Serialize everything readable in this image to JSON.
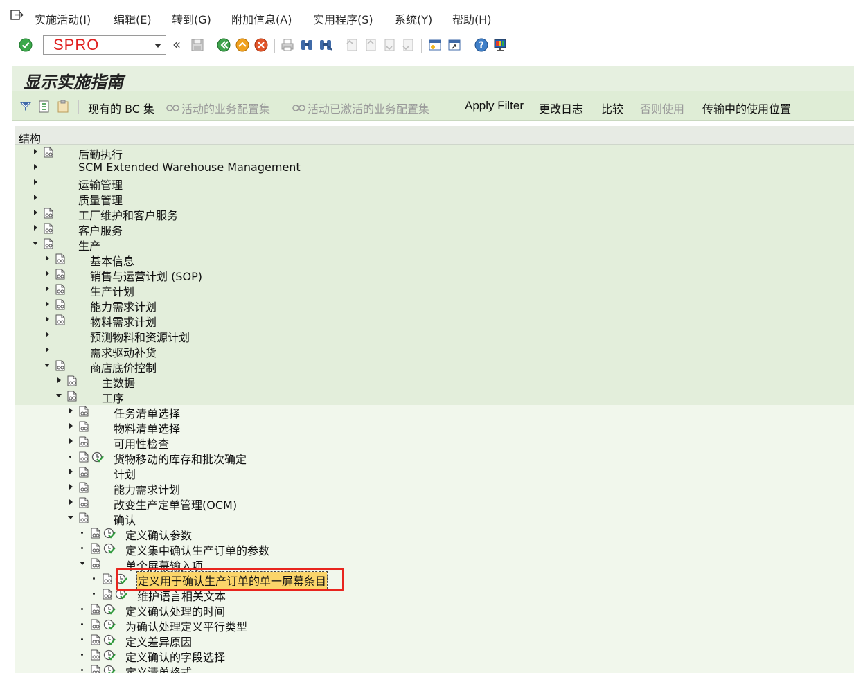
{
  "menu": {
    "items": [
      "实施活动(I)",
      "编辑(E)",
      "转到(G)",
      "附加信息(A)",
      "实用程序(S)",
      "系统(Y)",
      "帮助(H)"
    ]
  },
  "toolbar": {
    "command_value": "SPRO",
    "back_glyph": "«"
  },
  "screen": {
    "title": "显示实施指南"
  },
  "app_toolbar": {
    "current_bc_set": "现有的 BC 集",
    "active_config_sets": "活动的业务配置集",
    "activated_config_sets": "活动已激活的业务配置集",
    "apply_filter": "Apply Filter",
    "change_log": "更改日志",
    "compare": "比较",
    "where_used_else": "否则使用",
    "where_used_transport": "传输中的使用位置"
  },
  "tree": {
    "header": "结构",
    "rows": [
      {
        "label": "后勤执行",
        "expander": "r",
        "doc": true,
        "clock": false,
        "level": 0
      },
      {
        "label": "SCM Extended Warehouse Management",
        "expander": "r",
        "doc": false,
        "clock": false,
        "level": 0
      },
      {
        "label": "运输管理",
        "expander": "r",
        "doc": false,
        "clock": false,
        "level": 0
      },
      {
        "label": "质量管理",
        "expander": "r",
        "doc": false,
        "clock": false,
        "level": 0
      },
      {
        "label": "工厂维护和客户服务",
        "expander": "r",
        "doc": true,
        "clock": false,
        "level": 0
      },
      {
        "label": "客户服务",
        "expander": "r",
        "doc": true,
        "clock": false,
        "level": 0
      },
      {
        "label": "生产",
        "expander": "d",
        "doc": true,
        "clock": false,
        "level": 0
      },
      {
        "label": "基本信息",
        "expander": "r",
        "doc": true,
        "clock": false,
        "level": 1
      },
      {
        "label": "销售与运营计划 (SOP)",
        "expander": "r",
        "doc": true,
        "clock": false,
        "level": 1
      },
      {
        "label": "生产计划",
        "expander": "r",
        "doc": true,
        "clock": false,
        "level": 1
      },
      {
        "label": "能力需求计划",
        "expander": "r",
        "doc": true,
        "clock": false,
        "level": 1
      },
      {
        "label": "物料需求计划",
        "expander": "r",
        "doc": true,
        "clock": false,
        "level": 1
      },
      {
        "label": "预测物料和资源计划",
        "expander": "r",
        "doc": false,
        "clock": false,
        "level": 1
      },
      {
        "label": "需求驱动补货",
        "expander": "r",
        "doc": false,
        "clock": false,
        "level": 1
      },
      {
        "label": "商店底价控制",
        "expander": "d",
        "doc": true,
        "clock": false,
        "level": 1
      },
      {
        "label": "主数据",
        "expander": "r",
        "doc": true,
        "clock": false,
        "level": 2
      },
      {
        "label": "工序",
        "expander": "d",
        "doc": true,
        "clock": false,
        "level": 2
      },
      {
        "label": "任务清单选择",
        "expander": "r",
        "doc": true,
        "clock": false,
        "level": 3
      },
      {
        "label": "物料清单选择",
        "expander": "r",
        "doc": true,
        "clock": false,
        "level": 3
      },
      {
        "label": "可用性检查",
        "expander": "r",
        "doc": true,
        "clock": false,
        "level": 3
      },
      {
        "label": "货物移动的库存和批次确定",
        "expander": "b",
        "doc": true,
        "clock": true,
        "level": 3
      },
      {
        "label": "计划",
        "expander": "r",
        "doc": true,
        "clock": false,
        "level": 3
      },
      {
        "label": "能力需求计划",
        "expander": "r",
        "doc": true,
        "clock": false,
        "level": 3
      },
      {
        "label": "改变生产定单管理(OCM)",
        "expander": "r",
        "doc": true,
        "clock": false,
        "level": 3
      },
      {
        "label": "确认",
        "expander": "d",
        "doc": true,
        "clock": false,
        "level": 3
      },
      {
        "label": "定义确认参数",
        "expander": "b",
        "doc": true,
        "clock": true,
        "level": 4
      },
      {
        "label": "定义集中确认生产订单的参数",
        "expander": "b",
        "doc": true,
        "clock": true,
        "level": 4
      },
      {
        "label": "单个屏幕输入项",
        "expander": "d",
        "doc": true,
        "clock": false,
        "level": 4
      },
      {
        "label": "定义用于确认生产订单的单一屏幕条目",
        "expander": "b",
        "doc": true,
        "clock": true,
        "level": 5,
        "selected": true
      },
      {
        "label": "维护语言相关文本",
        "expander": "b",
        "doc": true,
        "clock": true,
        "level": 5
      },
      {
        "label": "定义确认处理的时间",
        "expander": "b",
        "doc": true,
        "clock": true,
        "level": 4
      },
      {
        "label": "为确认处理定义平行类型",
        "expander": "b",
        "doc": true,
        "clock": true,
        "level": 4
      },
      {
        "label": "定义差异原因",
        "expander": "b",
        "doc": true,
        "clock": true,
        "level": 4
      },
      {
        "label": "定义确认的字段选择",
        "expander": "b",
        "doc": true,
        "clock": true,
        "level": 4
      },
      {
        "label": "定义清单格式",
        "expander": "b",
        "doc": true,
        "clock": true,
        "level": 4
      }
    ]
  },
  "colors": {
    "command_text": "#e02020",
    "highlight_border": "#e8251e",
    "selected_bg": "#fbd56a",
    "tree_bg": "#f1f7ec"
  }
}
